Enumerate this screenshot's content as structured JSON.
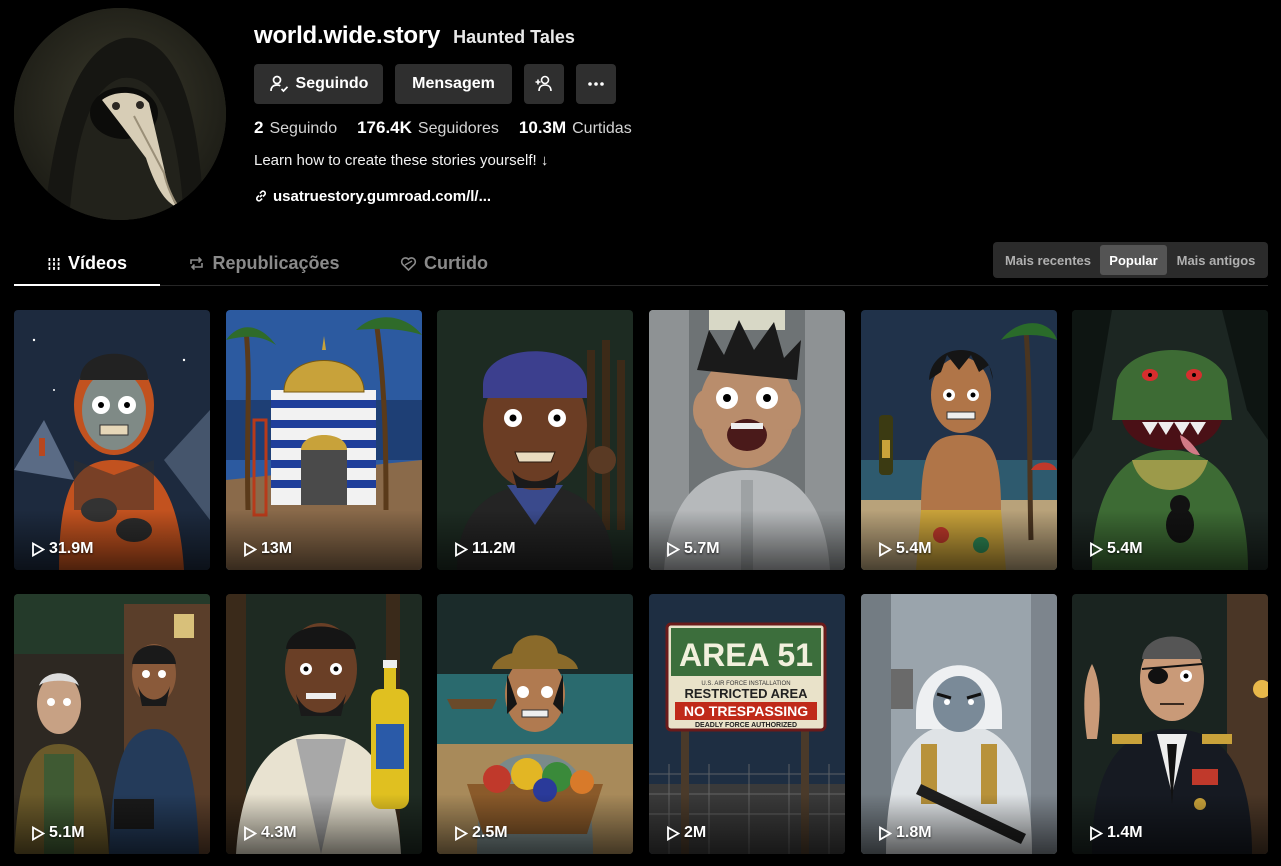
{
  "profile": {
    "username": "world.wide.story",
    "display_name": "Haunted Tales",
    "bio": "Learn how to create these stories yourself! ↓",
    "link": "usatruestory.gumroad.com/l/...",
    "avatar_icon": "plague-doctor-avatar"
  },
  "actions": {
    "following_label": "Seguindo",
    "message_label": "Mensagem",
    "add_friend_icon": "person-plus-icon",
    "more_icon": "more-dots-icon"
  },
  "stats": [
    {
      "value": "2",
      "label": "Seguindo"
    },
    {
      "value": "176.4K",
      "label": "Seguidores"
    },
    {
      "value": "10.3M",
      "label": "Curtidas"
    }
  ],
  "tabs": [
    {
      "label": "Vídeos",
      "icon": "grid-icon",
      "active": true
    },
    {
      "label": "Republicações",
      "icon": "repost-icon",
      "active": false
    },
    {
      "label": "Curtido",
      "icon": "heart-icon",
      "active": false
    }
  ],
  "sort": [
    {
      "label": "Mais recentes",
      "selected": false
    },
    {
      "label": "Popular",
      "selected": true
    },
    {
      "label": "Mais antigos",
      "selected": false
    }
  ],
  "videos": [
    {
      "views": "31.9M",
      "theme": "astronaut-in-orange-suit"
    },
    {
      "views": "13M",
      "theme": "striped-shrine-on-beach"
    },
    {
      "views": "11.2M",
      "theme": "man-with-bandana"
    },
    {
      "views": "5.7M",
      "theme": "screaming-man-in-hallway"
    },
    {
      "views": "5.4M",
      "theme": "boy-with-bottle-on-beach"
    },
    {
      "views": "5.4M",
      "theme": "giant-crocodile-monster"
    },
    {
      "views": "5.1M",
      "theme": "two-men-at-house"
    },
    {
      "views": "4.3M",
      "theme": "man-with-oil-bottle"
    },
    {
      "views": "2.5M",
      "theme": "woman-with-fruit-basket"
    },
    {
      "views": "2M",
      "theme": "area-51-sign"
    },
    {
      "views": "1.8M",
      "theme": "soldier-in-snow"
    },
    {
      "views": "1.4M",
      "theme": "general-with-eyepatch"
    }
  ],
  "sign": {
    "line1": "AREA 51",
    "line2": "U.S. AIR FORCE INSTALLATION",
    "line3": "RESTRICTED AREA",
    "line4": "NO TRESPASSING",
    "line5": "DEADLY FORCE AUTHORIZED"
  }
}
